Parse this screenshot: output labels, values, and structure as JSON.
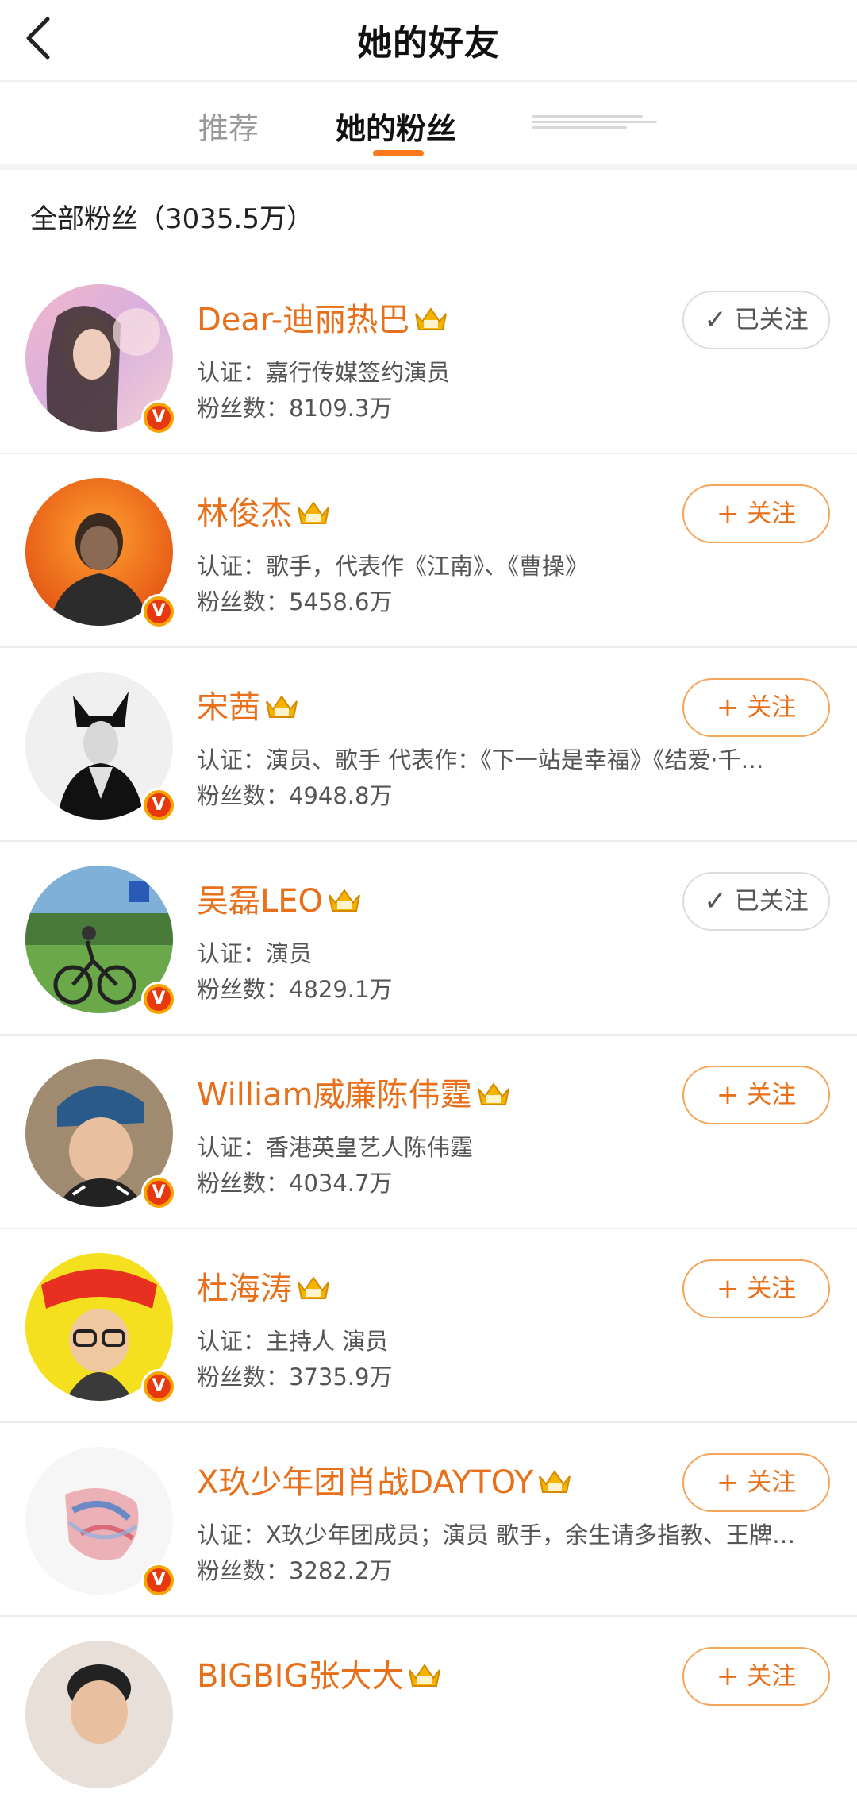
{
  "header": {
    "title": "她的好友"
  },
  "tabs": [
    {
      "label": "推荐"
    },
    {
      "label": "她的粉丝"
    }
  ],
  "section": {
    "title": "全部粉丝（3035.5万）"
  },
  "colors": {
    "accent": "#e8701a",
    "tab_indicator": "#ff7a1a",
    "vip_badge": "#f5a400"
  },
  "icons": {
    "back": "chevron-left-icon",
    "crown": "crown-icon",
    "verified": "verified-v-icon",
    "check": "check-icon",
    "plus": "plus-icon"
  },
  "users": [
    {
      "name": "Dear-迪丽热巴",
      "verify": "认证：嘉行传媒签约演员",
      "fans": "粉丝数：8109.3万",
      "button_icon": "✓",
      "button_label": "已关注",
      "followed": true
    },
    {
      "name": "林俊杰",
      "verify": "认证：歌手，代表作《江南》、《曹操》",
      "fans": "粉丝数：5458.6万",
      "button_icon": "+",
      "button_label": "关注",
      "followed": false
    },
    {
      "name": "宋茜",
      "verify": "认证：演员、歌手 代表作：《下一站是幸福》《结爱·千…",
      "fans": "粉丝数：4948.8万",
      "button_icon": "+",
      "button_label": "关注",
      "followed": false
    },
    {
      "name": "吴磊LEO",
      "verify": "认证：演员",
      "fans": "粉丝数：4829.1万",
      "button_icon": "✓",
      "button_label": "已关注",
      "followed": true
    },
    {
      "name": "William威廉陈伟霆",
      "verify": "认证：香港英皇艺人陈伟霆",
      "fans": "粉丝数：4034.7万",
      "button_icon": "+",
      "button_label": "关注",
      "followed": false
    },
    {
      "name": "杜海涛",
      "verify": "认证：主持人 演员",
      "fans": "粉丝数：3735.9万",
      "button_icon": "+",
      "button_label": "关注",
      "followed": false
    },
    {
      "name": "X玖少年团肖战DAYTOY",
      "verify": "认证：X玖少年团成员；演员 歌手，余生请多指教、王牌…",
      "fans": "粉丝数：3282.2万",
      "button_icon": "+",
      "button_label": "关注",
      "followed": false
    },
    {
      "name": "BIGBIG张大大",
      "verify": "",
      "fans": "",
      "button_icon": "+",
      "button_label": "关注",
      "followed": false
    }
  ],
  "badge_letter": "V"
}
